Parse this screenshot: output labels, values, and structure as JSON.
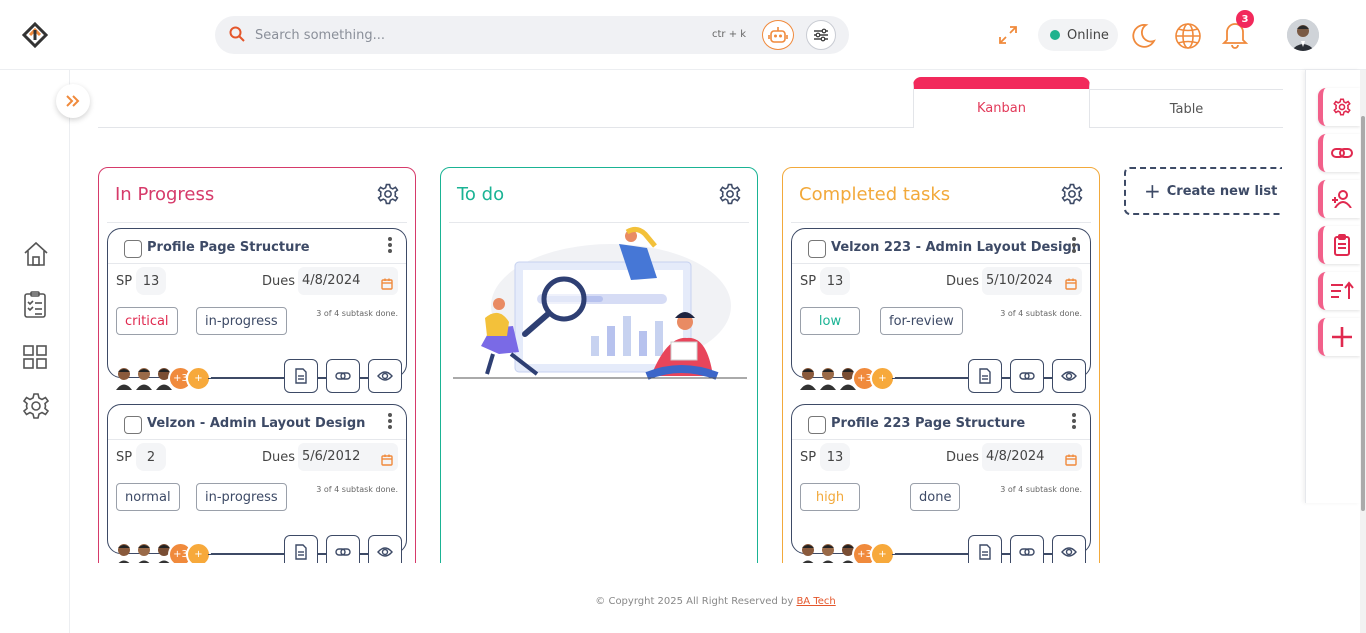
{
  "header": {
    "search": {
      "placeholder": "Search something...",
      "shortcut": "ctr + k"
    },
    "status": "Online",
    "notifications_count": "3"
  },
  "tabs": [
    {
      "label": "Kanban",
      "active": true
    },
    {
      "label": "Table",
      "active": false
    }
  ],
  "board": {
    "columns": [
      {
        "title": "In Progress",
        "color": "#d63a6a",
        "cards": [
          {
            "title": "Profile Page Structure",
            "sp_label": "SP",
            "sp": "13",
            "dues_label": "Dues",
            "due": "4/8/2024",
            "priority": "critical",
            "priority_color": "#e0294f",
            "status": "in-progress",
            "subtasks": "3 of 4 subtask done.",
            "more": "+3",
            "add": "+"
          },
          {
            "title": "Velzon - Admin Layout Design",
            "sp_label": "SP",
            "sp": "2",
            "dues_label": "Dues",
            "due": "5/6/2012",
            "priority": "normal",
            "priority_color": "#3d4a66",
            "status": "in-progress",
            "subtasks": "3 of 4 subtask done.",
            "more": "+3",
            "add": "+"
          }
        ]
      },
      {
        "title": "To do",
        "color": "#1ab394",
        "cards": []
      },
      {
        "title": "Completed tasks",
        "color": "#f2a93b",
        "cards": [
          {
            "title": "Velzon 223 - Admin Layout Design",
            "sp_label": "SP",
            "sp": "13",
            "dues_label": "Dues",
            "due": "5/10/2024",
            "priority": "low",
            "priority_color": "#1ab394",
            "status": "for-review",
            "subtasks": "3 of 4 subtask done.",
            "more": "+3",
            "add": "+"
          },
          {
            "title": "Profile 223 Page Structure",
            "sp_label": "SP",
            "sp": "13",
            "dues_label": "Dues",
            "due": "4/8/2024",
            "priority": "high",
            "priority_color": "#f2a93b",
            "status": "done",
            "subtasks": "3 of 4 subtask done.",
            "more": "+3",
            "add": "+"
          }
        ]
      }
    ],
    "create_list": "Create new list"
  },
  "icons": {
    "sidebar": [
      "home-icon",
      "checklist-icon",
      "grid-icon",
      "gear-icon"
    ],
    "right_panel": [
      "gear-icon",
      "link-icon",
      "user-plus-icon",
      "clipboard-icon",
      "sort-icon",
      "plus-icon"
    ]
  },
  "footer": {
    "text": "© Copyrght 2025 All Right Reserved by ",
    "link": "BA Tech"
  }
}
